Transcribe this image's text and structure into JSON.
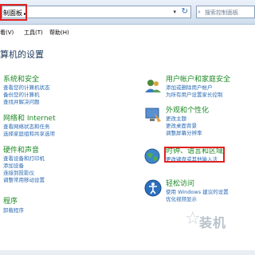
{
  "address": {
    "text": "制面板",
    "arrow": "▸",
    "dropdown": "▾",
    "refresh": "↻"
  },
  "search": {
    "placeholder": "搜索控制面板"
  },
  "menu": {
    "view": "看(V)",
    "tools": "工具(T)",
    "help": "帮助(H)"
  },
  "heading": "算机的设置",
  "left": [
    {
      "title": "系统和安全",
      "links": [
        "查看您的计算机状态",
        "备份您的计算机",
        "查找并解决问题"
      ]
    },
    {
      "title": "网络和 Internet",
      "links": [
        "查看网络状态和任务",
        "选择家庭组和共享选项"
      ]
    },
    {
      "title": "硬件和声音",
      "links": [
        "查看设备和打印机",
        "添加设备",
        "连接到投影仪",
        "调整常用移动设置"
      ]
    },
    {
      "title": "程序",
      "links": [
        "卸载程序"
      ]
    }
  ],
  "right": [
    {
      "title": "用户帐户和家庭安全",
      "links": [
        "添加或删除用户帐户",
        "为所有用户设置家长控制"
      ]
    },
    {
      "title": "外观和个性化",
      "links": [
        "更改主题",
        "更改桌面背景",
        "调整屏幕分辨率"
      ]
    },
    {
      "title": "时钟、语言和区域",
      "links": [
        "更改键盘或其他输入法"
      ]
    },
    {
      "title": "轻松访问",
      "links": [
        "使用 Windows 建议的设置",
        "优化视频显示"
      ]
    }
  ],
  "watermark": "装机"
}
